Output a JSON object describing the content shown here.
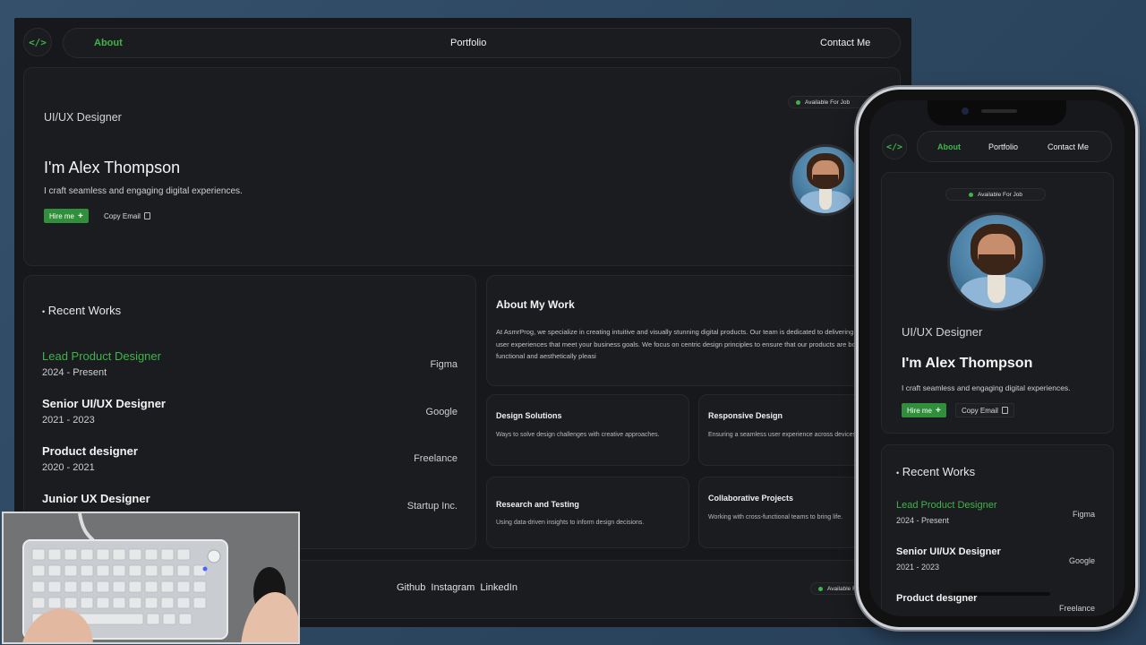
{
  "nav": {
    "logo": "</>",
    "items": [
      "About",
      "Portfolio",
      "Contact Me"
    ],
    "active": "About"
  },
  "hero": {
    "role": "UI/UX Designer",
    "name": "I'm Alex Thompson",
    "tagline": "I craft seamless and engaging digital experiences.",
    "hire": "Hire me",
    "hire_icon": "+",
    "copy": "Copy Email",
    "copy_icon": "copy-icon",
    "available": "Available For Job"
  },
  "works": {
    "title": "Recent Works",
    "items": [
      {
        "title": "Lead Product Designer",
        "dates": "2024 - Present",
        "company": "Figma"
      },
      {
        "title": "Senior UI/UX Designer",
        "dates": "2021 - 2023",
        "company": "Google"
      },
      {
        "title": "Product designer",
        "dates": "2020 - 2021",
        "company": "Freelance"
      },
      {
        "title": "Junior UX Designer",
        "dates": "",
        "company": "Startup Inc."
      }
    ]
  },
  "about": {
    "title": "About My Work",
    "text": "At AsmrProg, we specialize in creating intuitive and visually stunning digital products. Our team is dedicated to delivering high-quality user experiences that meet your business goals. We focus on centric design principles to ensure that our products are both functional and aesthetically pleasi"
  },
  "services": [
    {
      "title": "Design Solutions",
      "desc": "Ways to solve design challenges with creative approaches."
    },
    {
      "title": "Responsive Design",
      "desc": "Ensuring a seamless user experience across devices."
    },
    {
      "title": "Research and Testing",
      "desc": "Using data-driven insights to inform design decisions."
    },
    {
      "title": "Collaborative Projects",
      "desc": "Working with cross-functional teams to bring life."
    }
  ],
  "footer": {
    "links": [
      "Github",
      "Instagram",
      "LinkedIn"
    ],
    "available": "Available Fo"
  },
  "mobile": {
    "available": "Available For Job",
    "copy": "Copy Email",
    "freelance_partial": "Freelance"
  },
  "colors": {
    "accent": "#3fb44a",
    "bg": "#17181b",
    "card": "#1b1c1f",
    "page": "#2f4a64"
  }
}
